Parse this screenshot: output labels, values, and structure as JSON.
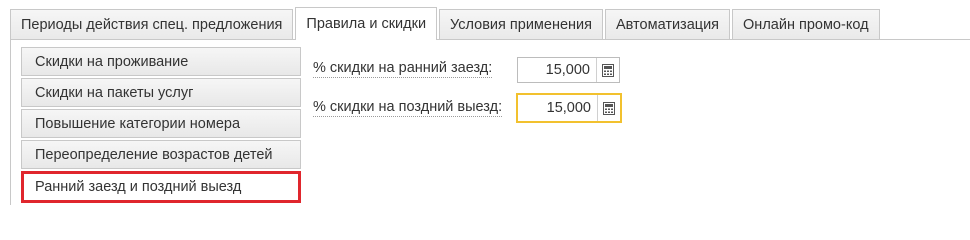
{
  "tabs": [
    {
      "label": "Периоды действия спец. предложения",
      "active": false
    },
    {
      "label": "Правила и скидки",
      "active": true
    },
    {
      "label": "Условия применения",
      "active": false
    },
    {
      "label": "Автоматизация",
      "active": false
    },
    {
      "label": "Онлайн промо-код",
      "active": false
    }
  ],
  "sidebar": {
    "items": [
      {
        "label": "Скидки на проживание",
        "active": false
      },
      {
        "label": "Скидки на пакеты услуг",
        "active": false
      },
      {
        "label": "Повышение категории номера",
        "active": false
      },
      {
        "label": "Переопределение возрастов детей",
        "active": false
      },
      {
        "label": "Ранний заезд и поздний выезд",
        "active": true
      }
    ]
  },
  "form": {
    "early_checkin": {
      "label": "% скидки на ранний заезд:",
      "value": "15,000"
    },
    "late_checkout": {
      "label": "% скидки на поздний выезд:",
      "value": "15,000"
    }
  },
  "colors": {
    "highlight_border": "#e0262d",
    "focus_border": "#f2c12e"
  },
  "icons": {
    "calculator": "calculator-icon"
  }
}
